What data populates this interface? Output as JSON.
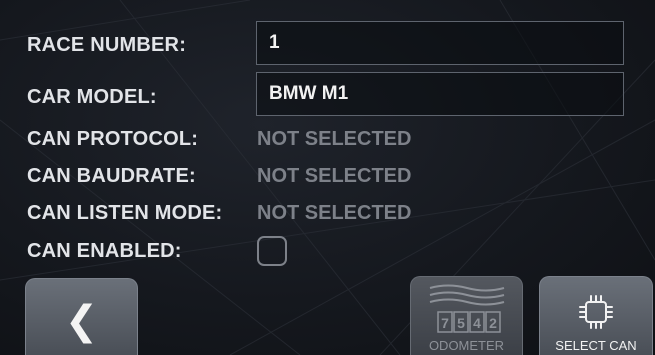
{
  "form": {
    "race_number": {
      "label": "RACE NUMBER:",
      "value": "1"
    },
    "car_model": {
      "label": "CAR MODEL:",
      "value": "BMW M1"
    },
    "can_protocol": {
      "label": "CAN PROTOCOL:",
      "value": "NOT SELECTED"
    },
    "can_baudrate": {
      "label": "CAN BAUDRATE:",
      "value": "NOT SELECTED"
    },
    "can_listen_mode": {
      "label": "CAN LISTEN MODE:",
      "value": "NOT SELECTED"
    },
    "can_enabled": {
      "label": "CAN ENABLED:",
      "checked": false
    }
  },
  "buttons": {
    "back": {
      "icon": "chevron-left-icon",
      "glyph": "❮"
    },
    "odometer": {
      "label": "ODOMETER",
      "icon": "odometer-icon",
      "digits": [
        "7",
        "5",
        "4",
        "2"
      ],
      "enabled": false
    },
    "select_can": {
      "label": "SELECT CAN",
      "icon": "chip-icon"
    }
  },
  "colors": {
    "background": "#15181e",
    "label": "#e2e4e8",
    "inactive_value": "#7d8189",
    "button": "#5c6169"
  }
}
